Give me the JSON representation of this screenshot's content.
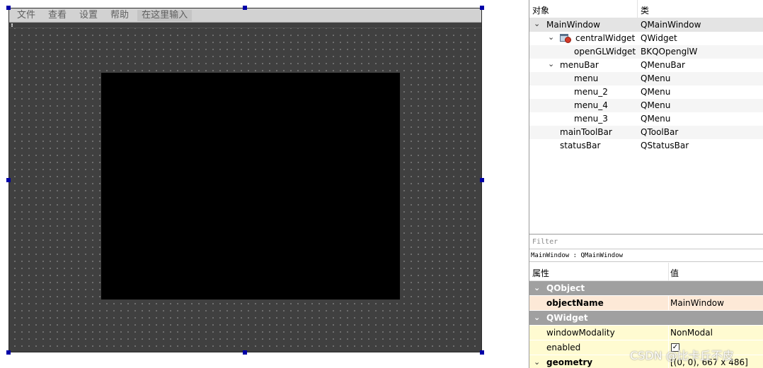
{
  "form": {
    "menus": [
      "文件",
      "查看",
      "设置",
      "帮助"
    ],
    "type_here": "在这里输入"
  },
  "object_inspector": {
    "header": {
      "object": "对象",
      "class": "类"
    },
    "rows": [
      {
        "name": "MainWindow",
        "class": "QMainWindow",
        "expanded": true
      },
      {
        "name": "centralWidget",
        "class": "QWidget",
        "icon": "widget-icon",
        "expanded": true
      },
      {
        "name": "openGLWidget",
        "class": "BKQOpenglW"
      },
      {
        "name": "menuBar",
        "class": "QMenuBar",
        "expanded": true
      },
      {
        "name": "menu",
        "class": "QMenu"
      },
      {
        "name": "menu_2",
        "class": "QMenu"
      },
      {
        "name": "menu_4",
        "class": "QMenu"
      },
      {
        "name": "menu_3",
        "class": "QMenu"
      },
      {
        "name": "mainToolBar",
        "class": "QToolBar"
      },
      {
        "name": "statusBar",
        "class": "QStatusBar"
      }
    ]
  },
  "property_editor": {
    "filter_placeholder": "Filter",
    "context": "MainWindow : QMainWindow",
    "header": {
      "property": "属性",
      "value": "值"
    },
    "groups": [
      {
        "name": "QObject",
        "color": "#a0a0a0"
      },
      {
        "name": "QWidget",
        "color": "#a0a0a0"
      }
    ],
    "properties": [
      {
        "name": "objectName",
        "value": "MainWindow"
      },
      {
        "name": "windowModality",
        "value": "NonModal"
      },
      {
        "name": "enabled",
        "checked": true
      },
      {
        "name": "geometry",
        "value": "[(0, 0), 667 x 486]"
      }
    ]
  },
  "colors": {
    "form_background": "#404040",
    "selection_handle": "#0000a8",
    "qobject_row": "#fde9d7",
    "qwidget_row": "#fffbd1"
  },
  "watermark": "CSDN @比卡丘不皮"
}
